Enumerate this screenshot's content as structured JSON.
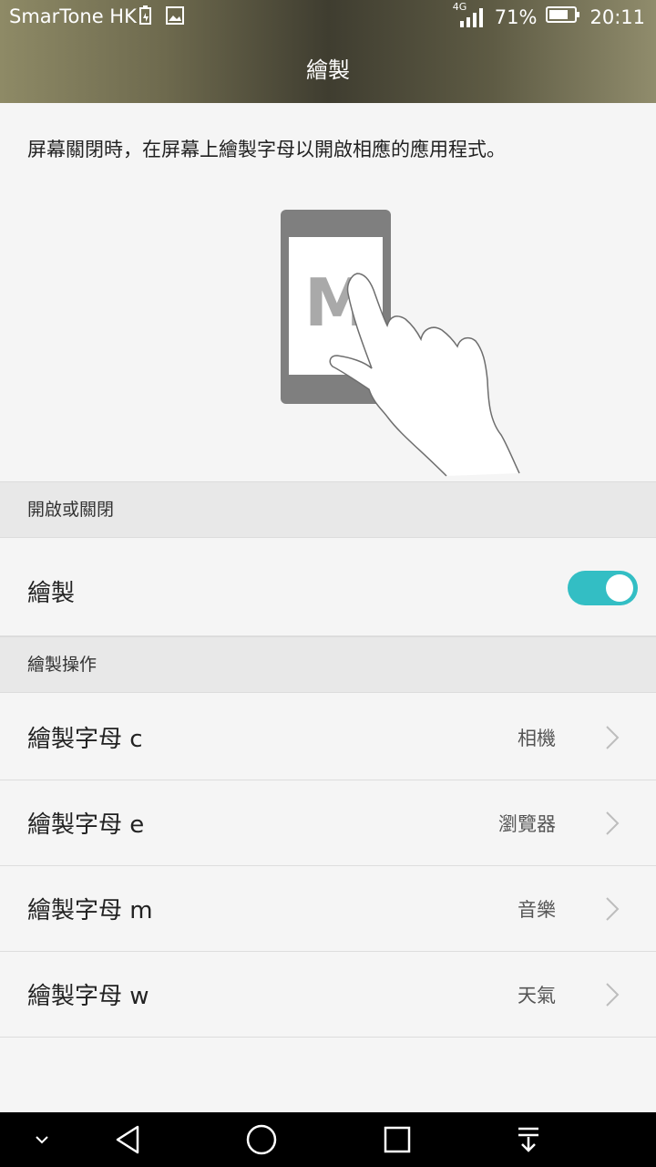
{
  "status_bar": {
    "carrier": "SmarTone HK",
    "network": "4G",
    "battery_percent": "71%",
    "time": "20:11"
  },
  "header": {
    "title": "繪製"
  },
  "description": "屏幕關閉時，在屏幕上繪製字母以開啟相應的應用程式。",
  "illustration": {
    "letter": "M"
  },
  "toggle_section": {
    "header": "開啟或關閉",
    "label": "繪製",
    "enabled": true
  },
  "actions_section": {
    "header": "繪製操作",
    "items": [
      {
        "label": "繪製字母 c",
        "value": "相機"
      },
      {
        "label": "繪製字母 e",
        "value": "瀏覽器"
      },
      {
        "label": "繪製字母 m",
        "value": "音樂"
      },
      {
        "label": "繪製字母 w",
        "value": "天氣"
      }
    ]
  },
  "colors": {
    "accent": "#33bec4",
    "section_bg": "#e8e8e8",
    "page_bg": "#f5f5f5"
  },
  "icons": {
    "status": [
      "battery-saver-icon",
      "image-icon",
      "signal-icon",
      "battery-icon"
    ],
    "nav": [
      "collapse-icon",
      "back-icon",
      "home-icon",
      "recents-icon",
      "notification-pulldown-icon"
    ]
  }
}
